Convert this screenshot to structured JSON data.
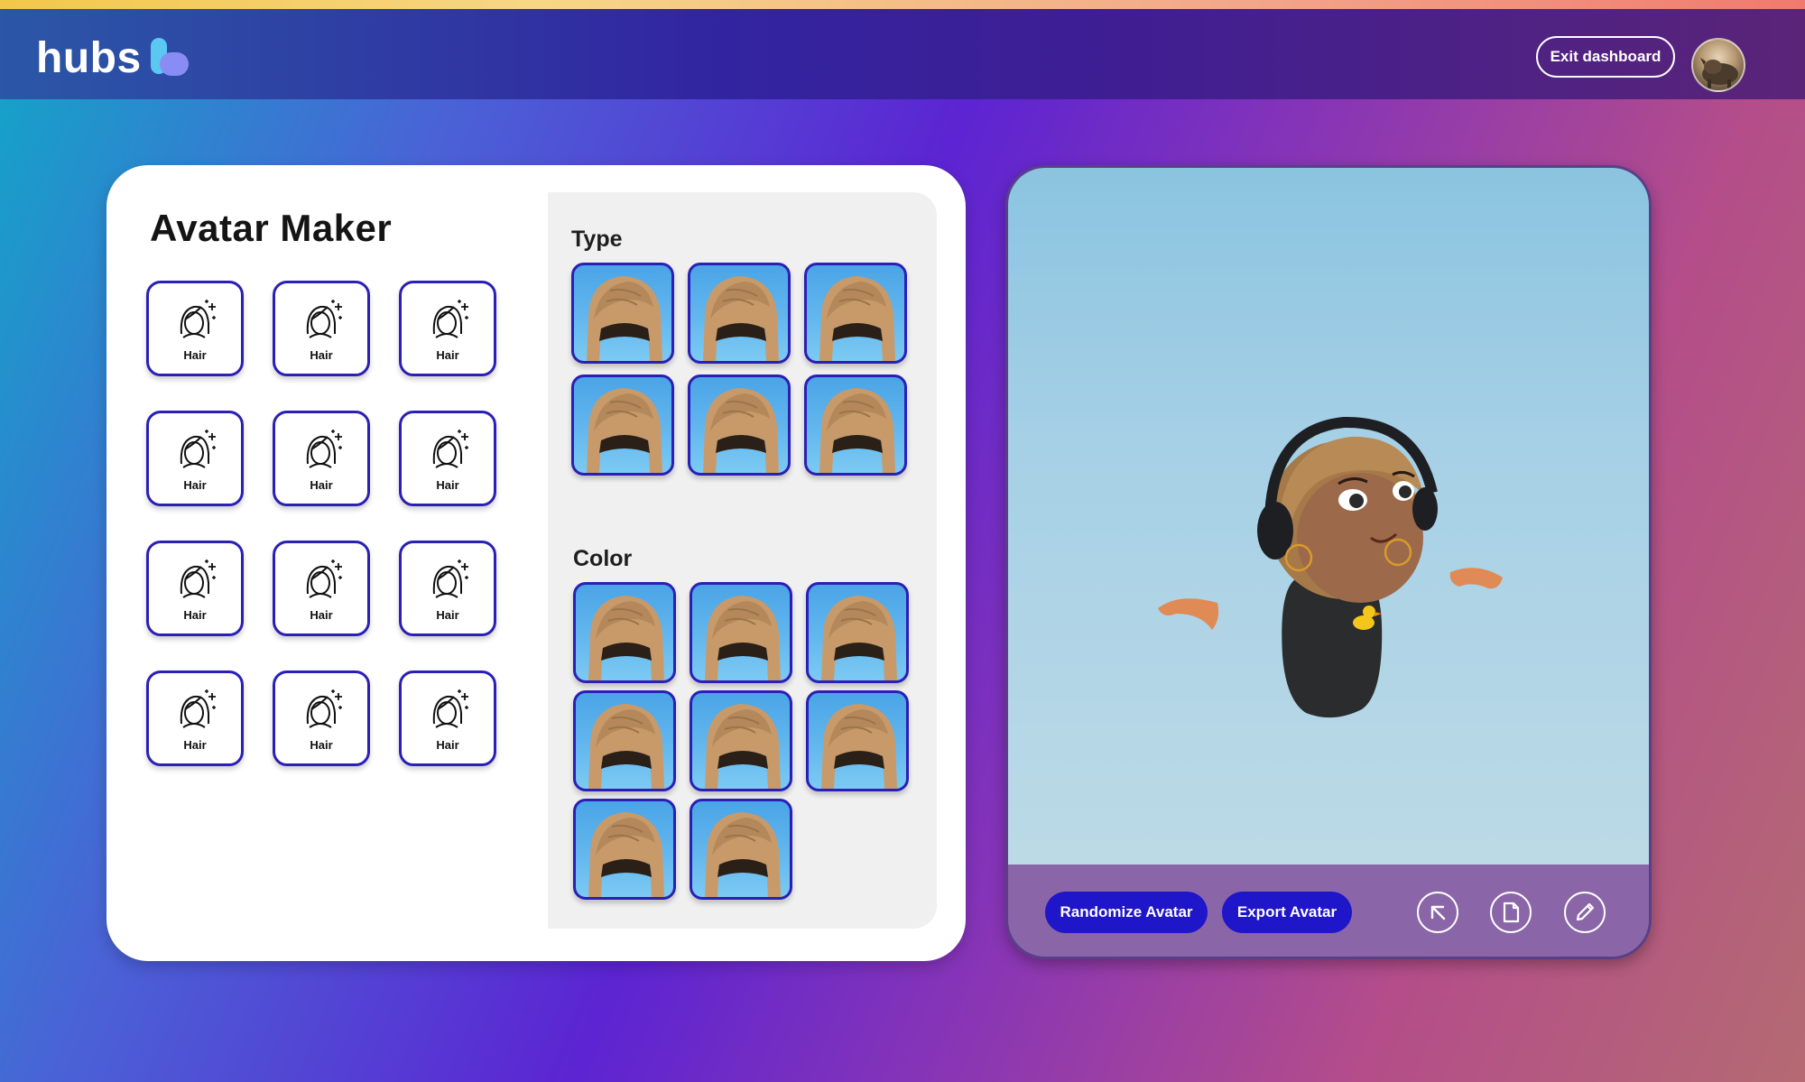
{
  "header": {
    "logo_text": "hubs",
    "exit_label": "Exit dashboard",
    "profile_icon": "avatar-profile-photo"
  },
  "avatar_maker": {
    "title": "Avatar Maker",
    "categories": [
      {
        "label": "Hair"
      },
      {
        "label": "Hair"
      },
      {
        "label": "Hair"
      },
      {
        "label": "Hair"
      },
      {
        "label": "Hair"
      },
      {
        "label": "Hair"
      },
      {
        "label": "Hair"
      },
      {
        "label": "Hair"
      },
      {
        "label": "Hair"
      },
      {
        "label": "Hair"
      },
      {
        "label": "Hair"
      },
      {
        "label": "Hair"
      }
    ],
    "type_label": "Type",
    "type_options_count": 6,
    "color_label": "Color",
    "color_options_count": 8
  },
  "preview": {
    "randomize_label": "Randomize Avatar",
    "export_label": "Export Avatar",
    "icons": [
      "expand-arrow-icon",
      "document-icon",
      "pencil-icon"
    ]
  },
  "colors": {
    "accent": "#2a1fb6",
    "button": "#1f15c9",
    "preview_bar": "#8a66a8"
  }
}
